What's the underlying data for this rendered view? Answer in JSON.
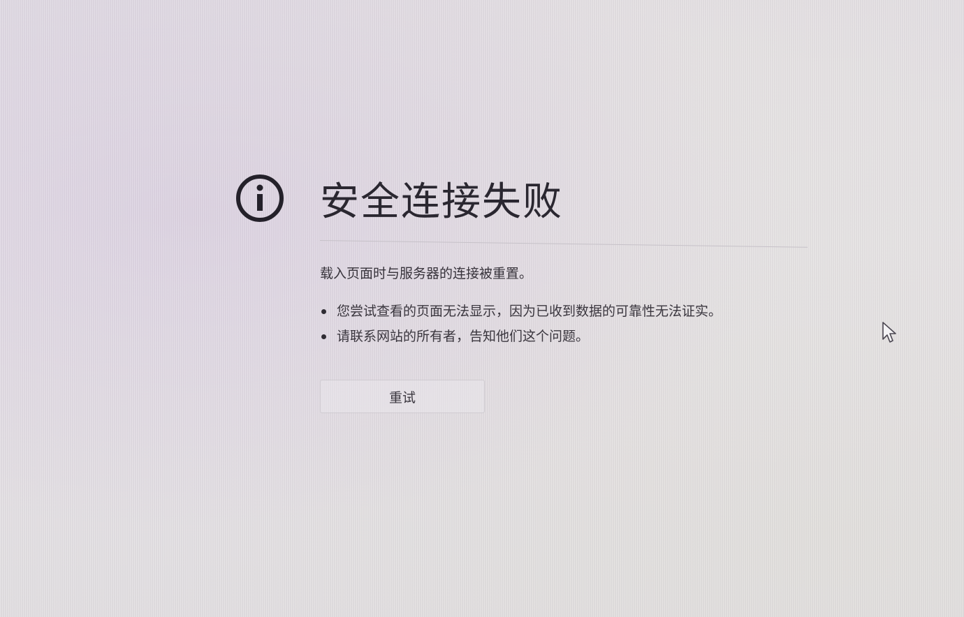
{
  "error": {
    "icon": "info-icon",
    "title": "安全连接失败",
    "message": "载入页面时与服务器的连接被重置。",
    "bullets": [
      "您尝试查看的页面无法显示，因为已收到数据的可靠性无法证实。",
      "请联系网站的所有者，告知他们这个问题。"
    ],
    "retry_label": "重试"
  },
  "cursor": {
    "icon": "mouse-pointer-icon"
  },
  "colors": {
    "background": "#e4e0e5",
    "text": "#2f2c33",
    "divider": "#c6c1c8"
  }
}
